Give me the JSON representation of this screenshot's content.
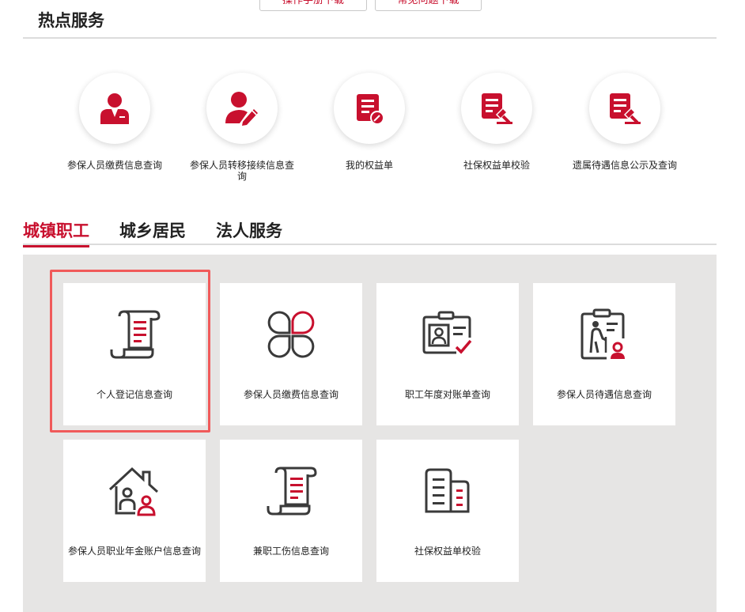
{
  "top_buttons": [
    {
      "label": "操作手册下载"
    },
    {
      "label": "常见问题下载"
    }
  ],
  "hot_section": {
    "title": "热点服务",
    "items": [
      {
        "label": "参保人员缴费信息查询",
        "icon": "insured-person-icon"
      },
      {
        "label": "参保人员转移接续信息查询",
        "icon": "person-edit-icon"
      },
      {
        "label": "我的权益单",
        "icon": "document-edit-icon"
      },
      {
        "label": "社保权益单校验",
        "icon": "document-stamp-icon"
      },
      {
        "label": "遗属待遇信息公示及查询",
        "icon": "document-stamp-icon"
      }
    ]
  },
  "tabs": [
    {
      "label": "城镇职工",
      "active": true
    },
    {
      "label": "城乡居民",
      "active": false
    },
    {
      "label": "法人服务",
      "active": false
    }
  ],
  "service_cards": [
    {
      "label": "个人登记信息查询",
      "icon": "scroll-document-icon",
      "selected": true
    },
    {
      "label": "参保人员缴费信息查询",
      "icon": "four-leaf-icon",
      "selected": false
    },
    {
      "label": "职工年度对账单查询",
      "icon": "id-card-check-icon",
      "selected": false
    },
    {
      "label": "参保人员待遇信息查询",
      "icon": "elderly-clipboard-icon",
      "selected": false
    },
    {
      "label": "参保人员职业年金账户信息查询",
      "icon": "house-person-icon",
      "selected": false
    },
    {
      "label": "兼职工伤信息查询",
      "icon": "scroll-document-icon",
      "selected": false
    },
    {
      "label": "社保权益单校验",
      "icon": "building-icon",
      "selected": false
    }
  ],
  "colors": {
    "accent_red": "#c8102e",
    "icon_dark": "#3a3a3a",
    "panel_bg": "#e6e5e4",
    "focus_outline": "#f05a5a"
  }
}
